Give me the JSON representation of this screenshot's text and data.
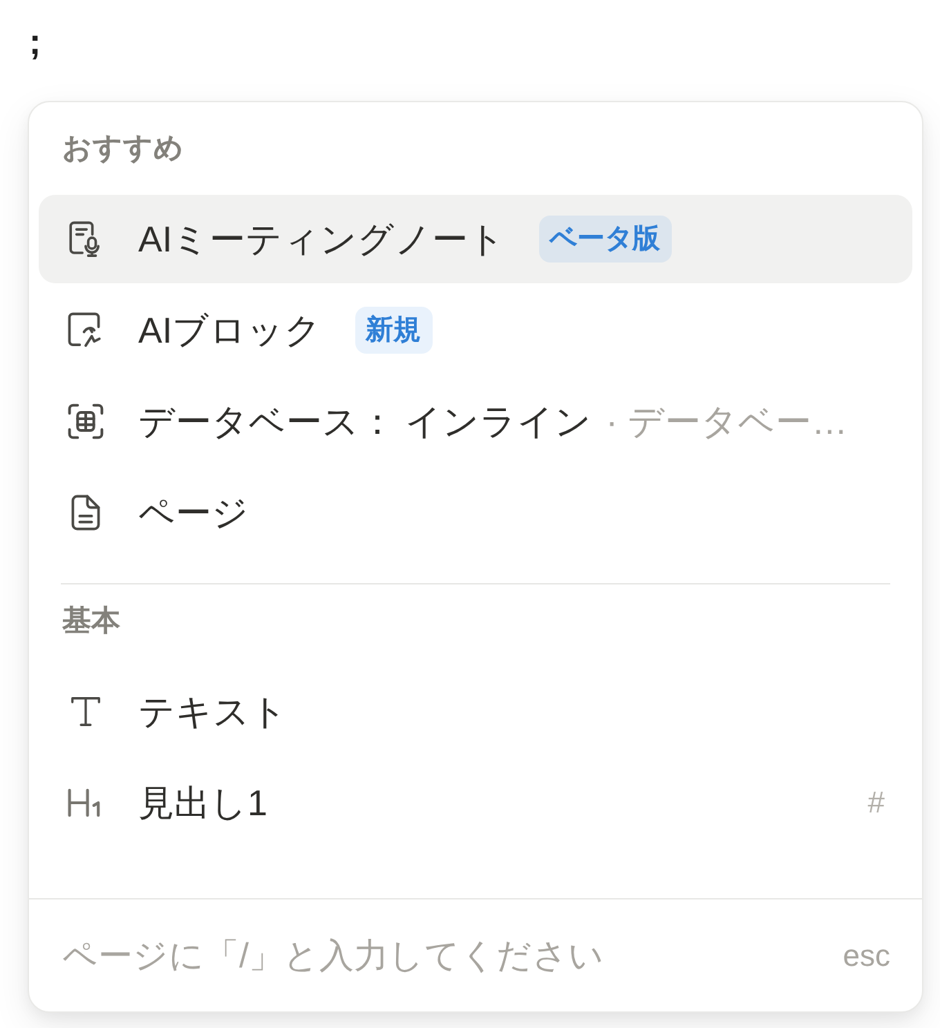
{
  "page": {
    "text": ";"
  },
  "menu": {
    "sections": [
      {
        "title": "おすすめ",
        "items": [
          {
            "kind": "meeting",
            "label": "AIミーティングノート",
            "badge": "ベータ版",
            "selected": true
          },
          {
            "kind": "ai",
            "label": "AIブロック",
            "badge": "新規",
            "selected": false
          },
          {
            "kind": "database",
            "label": "データベース： インライン",
            "hint": "· データベー…",
            "selected": false
          },
          {
            "kind": "page",
            "label": "ページ",
            "selected": false
          }
        ]
      },
      {
        "title": "基本",
        "items": [
          {
            "kind": "text",
            "label": "テキスト",
            "selected": false
          },
          {
            "kind": "heading",
            "label": "見出し1",
            "shortcut": "#",
            "selected": false
          }
        ]
      }
    ],
    "footer": {
      "hint": "ページに「/」と入力してください",
      "key": "esc"
    }
  }
}
